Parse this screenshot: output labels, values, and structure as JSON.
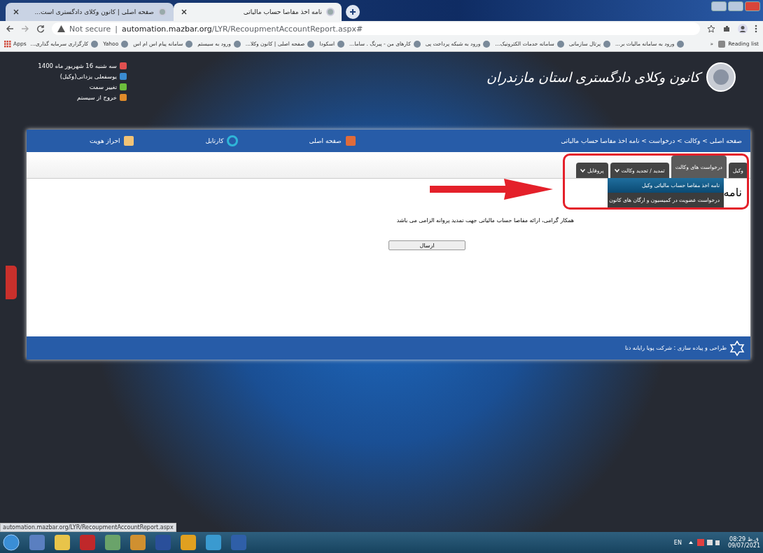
{
  "browser": {
    "tabs": [
      {
        "title": "نامه اخذ مفاصا حساب مالیاتی",
        "selected": true
      },
      {
        "title": "صفحه اصلی | کانون وکلای دادگستری است...",
        "selected": false
      }
    ],
    "address": {
      "security": "Not secure",
      "separator": "|",
      "host": "automation.mazbar.org",
      "path": "/LYR/RecoupmentAccountReport.aspx#"
    },
    "bookmarks": [
      {
        "kind": "site",
        "label": "ورود به سامانه مالیات بر..."
      },
      {
        "kind": "site",
        "label": "پرتال سازمانی"
      },
      {
        "kind": "site",
        "label": "سامانه خدمات الکترونیک..."
      },
      {
        "kind": "site",
        "label": "ورود به شبکه پرداخت پی"
      },
      {
        "kind": "site",
        "label": "کارهای من - پیرنگ . ساما..."
      },
      {
        "kind": "site",
        "label": "اسکودا"
      },
      {
        "kind": "site",
        "label": "صفحه اصلی | کانون وکلا..."
      },
      {
        "kind": "site",
        "label": "ورود به سیستم"
      },
      {
        "kind": "site",
        "label": "سامانه پیام اس ام اس"
      },
      {
        "kind": "site",
        "label": "Yahoo"
      },
      {
        "kind": "site",
        "label": "کارگزاری سرمایه گذاری..."
      },
      {
        "kind": "apps",
        "label": "Apps"
      }
    ],
    "overflow": "»",
    "reading_list": "Reading list"
  },
  "header": {
    "site_title": "کانون وکلای دادگستری استان مازندران",
    "user_links": [
      {
        "kind": "date",
        "text": "سه شنبه 16 شهریور ماه 1400"
      },
      {
        "kind": "user",
        "text": "یوسفعلی یزدانی(وکیل)"
      },
      {
        "kind": "switch",
        "text": "تغییر سمت"
      },
      {
        "kind": "logout",
        "text": "خروج از سیستم"
      }
    ]
  },
  "navbar": {
    "breadcrumb": "صفحه اصلی > وکالت > درخواست > نامه اخذ مفاصا حساب مالیاتی",
    "links": [
      {
        "kind": "home",
        "label": "صفحه اصلی"
      },
      {
        "kind": "inbox",
        "label": "کارتابل"
      },
      {
        "kind": "identity",
        "label": "احراز هویت"
      }
    ]
  },
  "menu": {
    "tabs": [
      {
        "label": "وکیل",
        "selected": false,
        "has_caret": false
      },
      {
        "label": "درخواست های وکالت",
        "selected": true,
        "has_caret": false,
        "dropdown": [
          {
            "label": "نامه اخذ مفاصا حساب مالیاتی وکیل",
            "selected": true
          },
          {
            "label": "درخواست عضویت در کمیسیون و ارگان های کانون",
            "selected": false
          }
        ]
      },
      {
        "label": "تمدید / تجدید وکالت",
        "selected": false,
        "has_caret": true
      },
      {
        "label": "پروفایل",
        "selected": false,
        "has_caret": true
      }
    ]
  },
  "content": {
    "title": "نامه",
    "message": "همکار گرامی، ارائه مفاصا حساب مالیاتی جهت تمدید پروانه الزامی می باشد",
    "submit_button": "ارسال"
  },
  "footer": {
    "credit": "طراحی و پیاده سازی : شرکت پویا رایانه دنا"
  },
  "status_url": "automation.mazbar.org/LYR/RecoupmentAccountReport.aspx",
  "taskbar": {
    "language": "EN",
    "time": "08:29 ق.ظ",
    "date": "09/07/2021"
  }
}
